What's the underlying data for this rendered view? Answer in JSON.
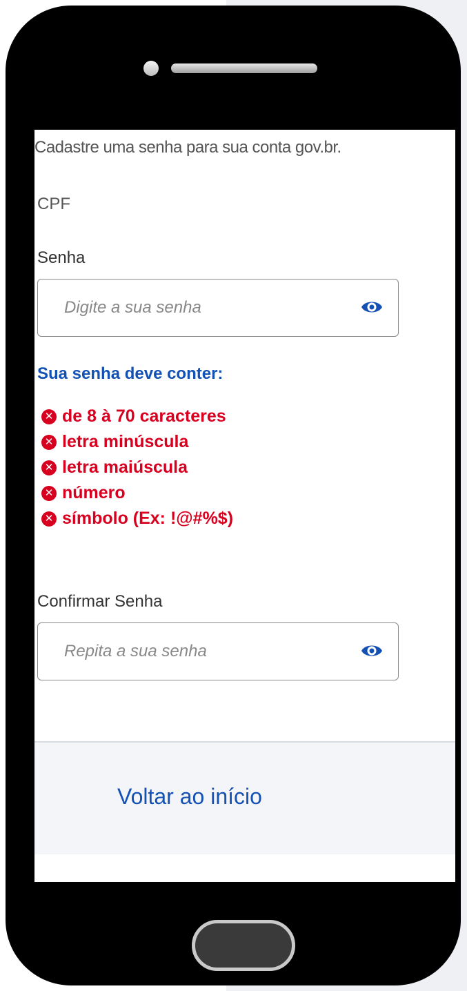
{
  "intro_text": "Cadastre uma senha para sua conta gov.br.",
  "cpf_label": "CPF",
  "password": {
    "label": "Senha",
    "placeholder": "Digite a sua senha",
    "toggle_icon": "eye-icon"
  },
  "requirements": {
    "title": "Sua senha deve conter:",
    "status_icon": "x-circle-icon",
    "items": [
      "de 8 à 70 caracteres",
      "letra minúscula",
      "letra maiúscula",
      "número",
      "símbolo (Ex: !@#%$)"
    ]
  },
  "confirm": {
    "label": "Confirmar Senha",
    "placeholder": "Repita a sua senha",
    "toggle_icon": "eye-icon"
  },
  "footer": {
    "back_label": "Voltar ao início"
  },
  "colors": {
    "primary": "#1351b4",
    "error": "#d8001f",
    "phone_frame": "#000000"
  }
}
